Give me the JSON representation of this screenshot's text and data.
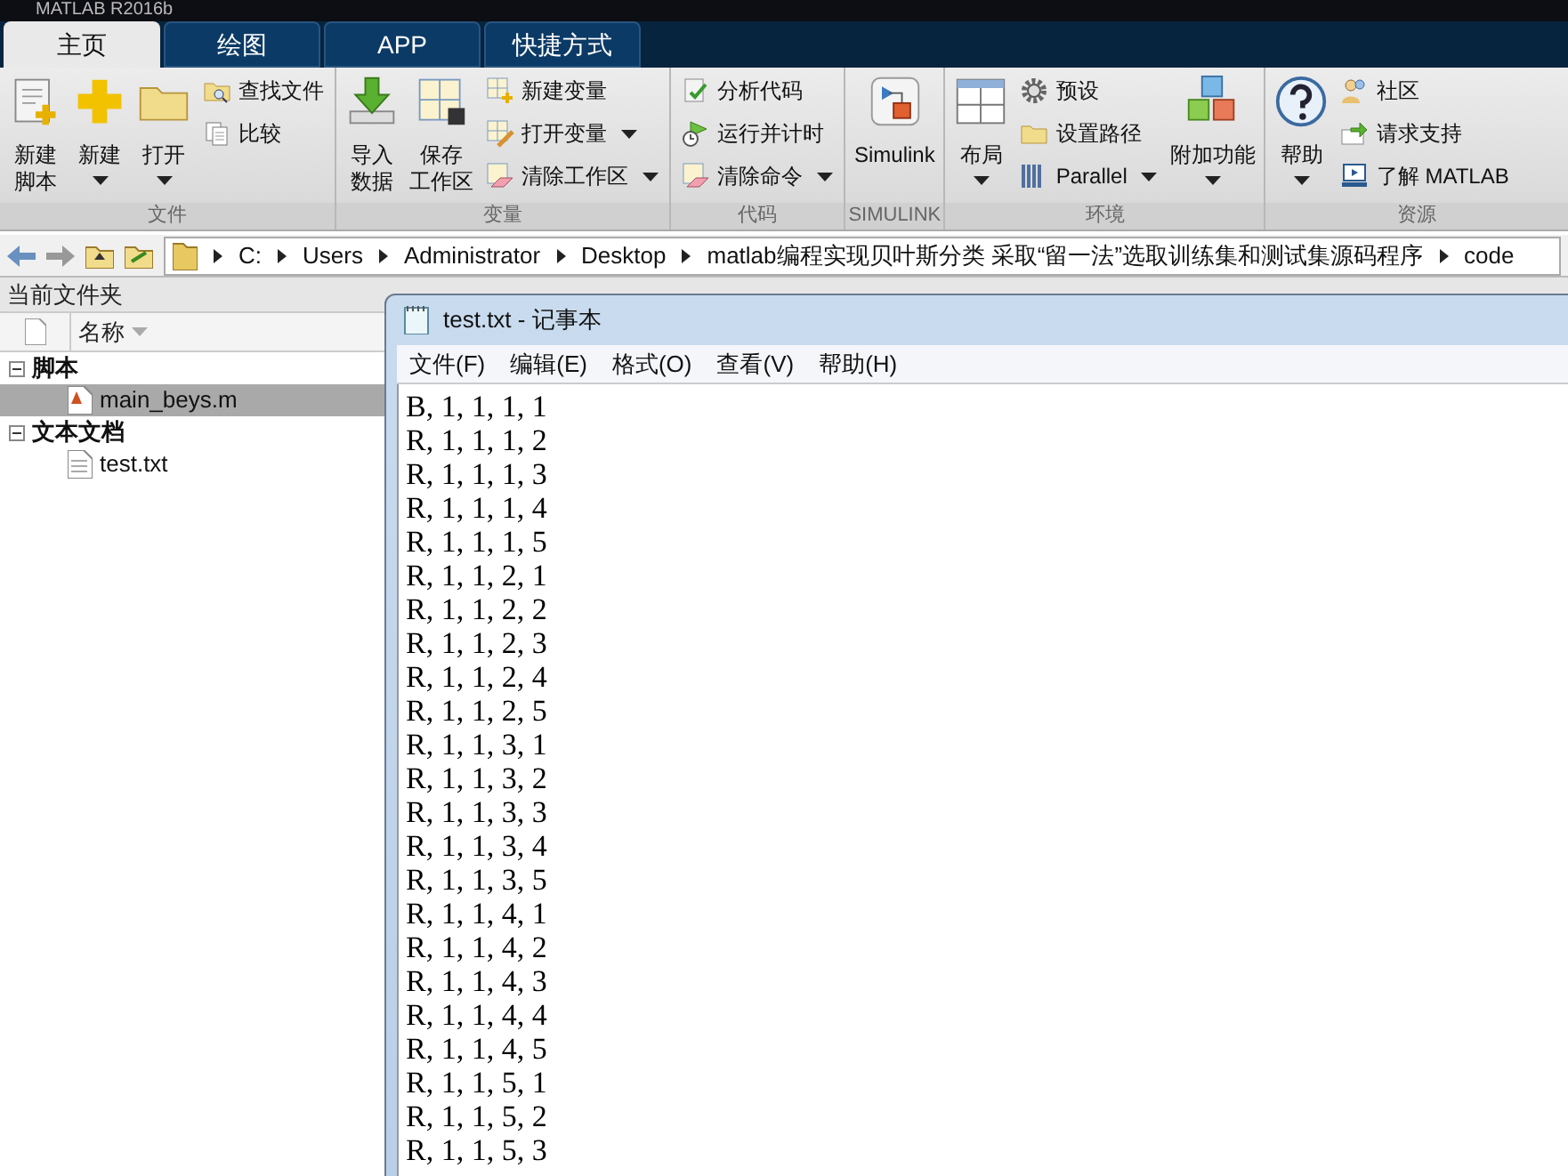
{
  "window": {
    "title": "MATLAB R2016b"
  },
  "tabs": [
    {
      "label": "主页",
      "selected": true
    },
    {
      "label": "绘图",
      "selected": false
    },
    {
      "label": "APP",
      "selected": false
    },
    {
      "label": "快捷方式",
      "selected": false
    }
  ],
  "ribbon": {
    "groups": [
      {
        "label": "文件",
        "items": [
          {
            "kind": "large",
            "lines": [
              "新建",
              "脚本"
            ],
            "dropdown": false
          },
          {
            "kind": "large",
            "lines": [
              "新建"
            ],
            "dropdown": true
          },
          {
            "kind": "large",
            "lines": [
              "打开"
            ],
            "dropdown": true
          },
          {
            "kind": "stack",
            "buttons": [
              {
                "label": "查找文件",
                "dropdown": false
              },
              {
                "label": "比较",
                "dropdown": false
              }
            ]
          }
        ]
      },
      {
        "label": "变量",
        "items": [
          {
            "kind": "large",
            "lines": [
              "导入",
              "数据"
            ],
            "dropdown": false
          },
          {
            "kind": "large",
            "lines": [
              "保存",
              "工作区"
            ],
            "dropdown": false
          },
          {
            "kind": "stack",
            "buttons": [
              {
                "label": "新建变量",
                "dropdown": false
              },
              {
                "label": "打开变量",
                "dropdown": true
              },
              {
                "label": "清除工作区",
                "dropdown": true
              }
            ]
          }
        ]
      },
      {
        "label": "代码",
        "items": [
          {
            "kind": "stack",
            "buttons": [
              {
                "label": "分析代码",
                "dropdown": false
              },
              {
                "label": "运行并计时",
                "dropdown": false
              },
              {
                "label": "清除命令",
                "dropdown": true
              }
            ]
          }
        ]
      },
      {
        "label": "SIMULINK",
        "items": [
          {
            "kind": "large",
            "lines": [
              "Simulink"
            ],
            "dropdown": false
          }
        ]
      },
      {
        "label": "环境",
        "items": [
          {
            "kind": "large",
            "lines": [
              "布局"
            ],
            "dropdown": true
          },
          {
            "kind": "stack",
            "buttons": [
              {
                "label": "预设",
                "dropdown": false
              },
              {
                "label": "设置路径",
                "dropdown": false
              },
              {
                "label": "Parallel",
                "dropdown": true
              }
            ]
          },
          {
            "kind": "large",
            "lines": [
              "附加功能"
            ],
            "dropdown": true
          }
        ]
      },
      {
        "label": "资源",
        "items": [
          {
            "kind": "large",
            "lines": [
              "帮助"
            ],
            "dropdown": true
          },
          {
            "kind": "stack",
            "buttons": [
              {
                "label": "社区",
                "dropdown": false
              },
              {
                "label": "请求支持",
                "dropdown": false
              },
              {
                "label": "了解 MATLAB",
                "dropdown": false
              }
            ]
          }
        ]
      }
    ]
  },
  "address_bar": {
    "path": [
      "C:",
      "Users",
      "Administrator",
      "Desktop",
      "matlab编程实现贝叶斯分类 采取“留一法”选取训练集和测试集源码程序",
      "code"
    ]
  },
  "current_folder": {
    "title": "当前文件夹",
    "column": "名称",
    "groups": [
      {
        "label": "脚本",
        "expanded": true,
        "children": [
          {
            "name": "main_beys.m",
            "kind": "script",
            "selected": true
          }
        ]
      },
      {
        "label": "文本文档",
        "expanded": true,
        "children": [
          {
            "name": "test.txt",
            "kind": "text",
            "selected": false
          }
        ]
      }
    ]
  },
  "notepad": {
    "title": "test.txt - 记事本",
    "menu": [
      "文件(F)",
      "编辑(E)",
      "格式(O)",
      "查看(V)",
      "帮助(H)"
    ],
    "lines": [
      "B, 1, 1, 1, 1",
      "R, 1, 1, 1, 2",
      "R, 1, 1, 1, 3",
      "R, 1, 1, 1, 4",
      "R, 1, 1, 1, 5",
      "R, 1, 1, 2, 1",
      "R, 1, 1, 2, 2",
      "R, 1, 1, 2, 3",
      "R, 1, 1, 2, 4",
      "R, 1, 1, 2, 5",
      "R, 1, 1, 3, 1",
      "R, 1, 1, 3, 2",
      "R, 1, 1, 3, 3",
      "R, 1, 1, 3, 4",
      "R, 1, 1, 3, 5",
      "R, 1, 1, 4, 1",
      "R, 1, 1, 4, 2",
      "R, 1, 1, 4, 3",
      "R, 1, 1, 4, 4",
      "R, 1, 1, 4, 5",
      "R, 1, 1, 5, 1",
      "R, 1, 1, 5, 2",
      "R, 1, 1, 5, 3"
    ]
  }
}
